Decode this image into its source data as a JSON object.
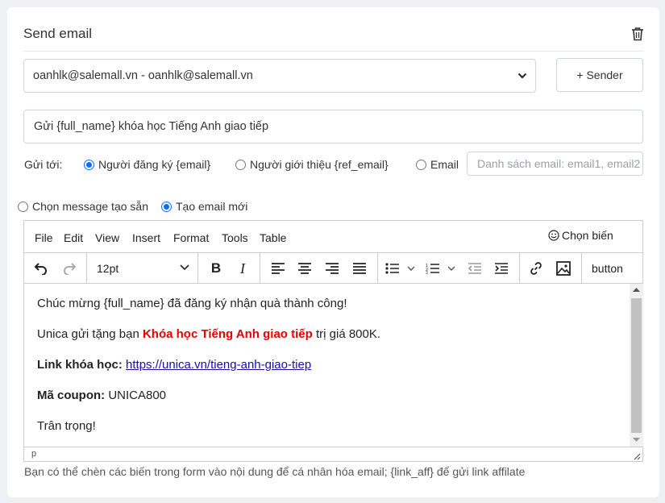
{
  "card": {
    "title": "Send email",
    "sender_select": "oanhlk@salemall.vn - oanhlk@salemall.vn",
    "sender_button": "+ Sender",
    "subject": "Gửi {full_name} khóa học Tiếng Anh giao tiếp",
    "send_to": {
      "label": "Gửi tới:",
      "options": [
        "Người đăng ký {email}",
        "Người giới thiệu {ref_email}",
        "Email"
      ],
      "selected_index": 0,
      "email_placeholder": "Danh sách email: email1, email2"
    },
    "message_mode": {
      "options": [
        "Chọn message tạo sẵn",
        "Tạo email mới"
      ],
      "selected_index": 1
    }
  },
  "editor": {
    "menu": [
      "File",
      "Edit",
      "View",
      "Insert",
      "Format",
      "Tools",
      "Table"
    ],
    "choose_variable": "Chọn biến",
    "font_size": "12pt",
    "custom_button": "button",
    "content": {
      "line1": "Chúc mừng {full_name} đã đăng ký nhận quà thành công!",
      "line2_pre": "Unica gửi tặng bạn ",
      "line2_highlight": "Khóa học Tiếng Anh giao tiếp",
      "line2_post": " trị giá 800K.",
      "line3_label": "Link khóa học:",
      "line3_link": "https://unica.vn/tieng-anh-giao-tiep",
      "line4_label": "Mã coupon:",
      "line4_value": " UNICA800",
      "line5": "Trân trọng!"
    },
    "status_path": "p",
    "highlight_color": "#e60000"
  },
  "hint": "Bạn có thể chèn các biến trong form vào nội dung để cá nhân hóa email; {link_aff} để gửi link affilate"
}
